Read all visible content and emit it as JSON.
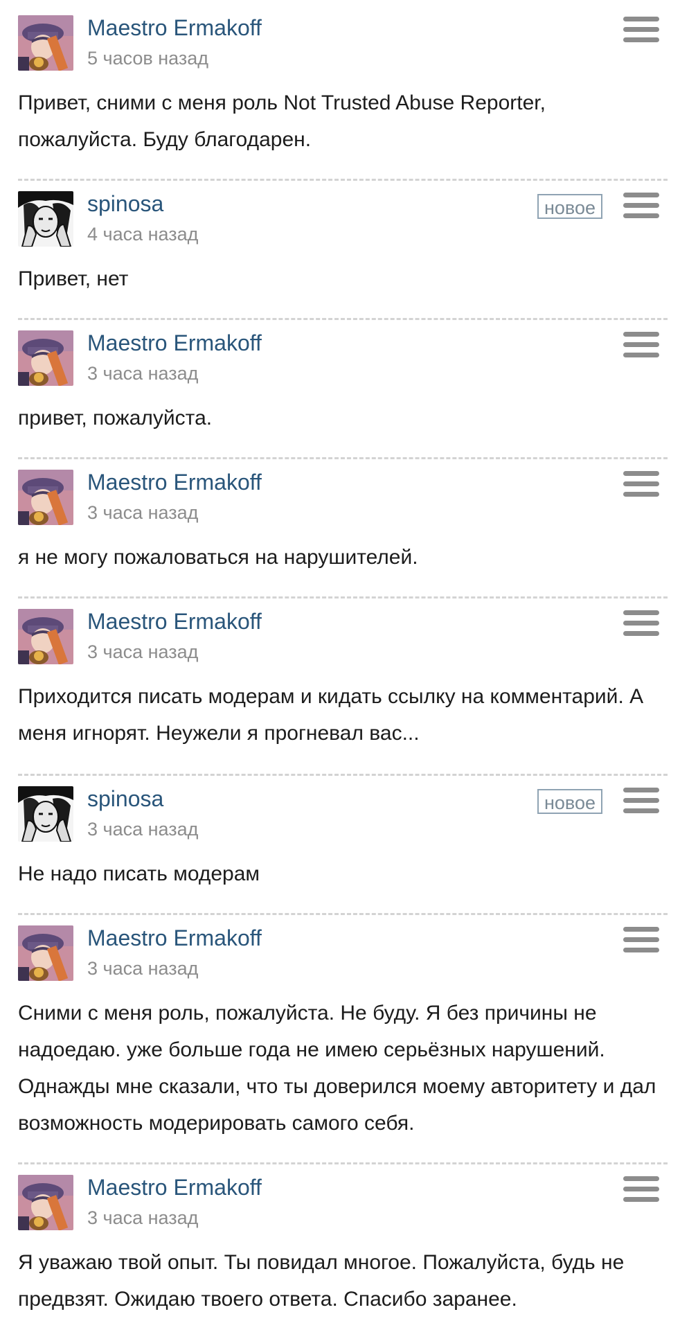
{
  "labels": {
    "new_badge": "новое"
  },
  "comments": [
    {
      "author": "Maestro Ermakoff",
      "time": "5 часов назад",
      "text": "Привет, сними с меня роль Not Trusted Abuse Reporter, пожалуйста. Буду благодарен.",
      "is_new": false,
      "avatar": "maestro-avatar"
    },
    {
      "author": "spinosa",
      "time": "4 часа назад",
      "text": "Привет, нет",
      "is_new": true,
      "avatar": "spinosa-avatar"
    },
    {
      "author": "Maestro Ermakoff",
      "time": "3 часа назад",
      "text": "привет, пожалуйста.",
      "is_new": false,
      "avatar": "maestro-avatar"
    },
    {
      "author": "Maestro Ermakoff",
      "time": "3 часа назад",
      "text": "я не могу пожаловаться на нарушителей.",
      "is_new": false,
      "avatar": "maestro-avatar"
    },
    {
      "author": "Maestro Ermakoff",
      "time": "3 часа назад",
      "text": "Приходится писать модерам и кидать ссылку на комментарий. А меня игнорят. Неужели я прогневал вас...",
      "is_new": false,
      "avatar": "maestro-avatar"
    },
    {
      "author": "spinosa",
      "time": "3 часа назад",
      "text": "Не надо писать модерам",
      "is_new": true,
      "avatar": "spinosa-avatar"
    },
    {
      "author": "Maestro Ermakoff",
      "time": "3 часа назад",
      "text": "Сними с меня роль, пожалуйста. Не буду. Я без причины не надоедаю. уже больше года не имею серьёзных нарушений. Однажды мне сказали, что ты доверился моему авторитету и дал возможность модерировать самого себя.",
      "is_new": false,
      "avatar": "maestro-avatar"
    },
    {
      "author": "Maestro Ermakoff",
      "time": "3 часа назад",
      "text": "Я уважаю твой опыт. Ты повидал многое. Пожалуйста, будь не предвзят. Ожидаю твоего ответа. Спасибо заранее.",
      "is_new": false,
      "avatar": "maestro-avatar"
    }
  ],
  "colors": {
    "author": "#29557a",
    "time": "#8c8c8c",
    "text": "#1c1c1c",
    "divider": "#d3d3d3",
    "menu": "#8c8c8c",
    "badge_border": "#8fa3b3"
  },
  "icons": {
    "menu": "hamburger-menu-icon"
  }
}
